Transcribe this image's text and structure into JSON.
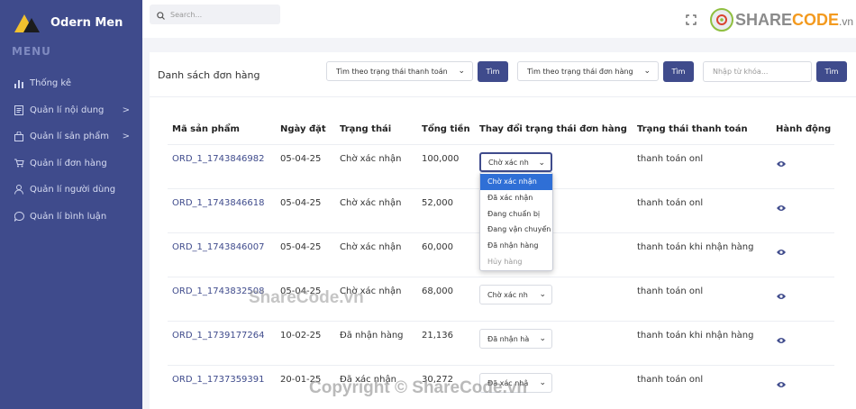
{
  "brand": {
    "name": "Odern Men"
  },
  "sidebar": {
    "menu_title": "MENU",
    "items": [
      {
        "label": "Thống kê",
        "icon": "bar-chart-icon"
      },
      {
        "label": "Quản lí nội dung",
        "icon": "document-icon",
        "chevron": ">"
      },
      {
        "label": "Quản lí sản phẩm",
        "icon": "bag-icon",
        "chevron": ">"
      },
      {
        "label": "Quản lí đơn hàng",
        "icon": "cart-icon"
      },
      {
        "label": "Quản lí người dùng",
        "icon": "user-icon"
      },
      {
        "label": "Quản lí bình luận",
        "icon": "comment-icon"
      }
    ]
  },
  "topbar": {
    "search_placeholder": "Search...",
    "watermark_logo": {
      "share": "SHARE",
      "code": "CODE",
      "vn": ".vn"
    }
  },
  "card": {
    "title": "Danh sách đơn hàng",
    "filter_payment": "Tìm theo trạng thái thanh toán",
    "filter_order": "Tìm theo trạng thái đơn hàng",
    "keyword_placeholder": "Nhập từ khóa...",
    "search_button": "Tìm"
  },
  "table": {
    "headers": [
      "Mã sản phẩm",
      "Ngày đặt",
      "Trạng thái",
      "Tổng tiền",
      "Thay đổi trạng thái đơn hàng",
      "Trạng thái thanh toán",
      "Hành động"
    ],
    "rows": [
      {
        "code": "ORD_1_1743846982",
        "date": "05-04-25",
        "status": "Chờ xác nhận",
        "total": "100,000",
        "select": "Chờ xác nh",
        "payment": "thanh toán onl"
      },
      {
        "code": "ORD_1_1743846618",
        "date": "05-04-25",
        "status": "Chờ xác nhận",
        "total": "52,000",
        "select": "",
        "payment": "thanh toán onl"
      },
      {
        "code": "ORD_1_1743846007",
        "date": "05-04-25",
        "status": "Chờ xác nhận",
        "total": "60,000",
        "select": "",
        "payment": "thanh toán khi nhận hàng"
      },
      {
        "code": "ORD_1_1743832508",
        "date": "05-04-25",
        "status": "Chờ xác nhận",
        "total": "68,000",
        "select": "Chờ xác nh",
        "payment": "thanh toán onl"
      },
      {
        "code": "ORD_1_1739177264",
        "date": "10-02-25",
        "status": "Đã nhận hàng",
        "total": "21,136",
        "select": "Đã nhận hà",
        "payment": "thanh toán khi nhận hàng"
      },
      {
        "code": "ORD_1_1737359391",
        "date": "20-01-25",
        "status": "Đã xác nhận",
        "total": "30,272",
        "select": "Đã xác nhậ",
        "payment": "thanh toán onl"
      }
    ],
    "dropdown_options": [
      "Chờ xác nhận",
      "Đã xác nhận",
      "Đang chuẩn bị",
      "Đang vận chuyển",
      "Đã nhận hàng",
      "Hủy hàng"
    ]
  },
  "watermarks": {
    "middle": "ShareCode.vn",
    "bottom": "Copyright © ShareCode.vn"
  },
  "colors": {
    "sidebar": "#3f4b8c",
    "accent": "#3f4b8c",
    "link": "#3f4b8c",
    "dropdown_active": "#2f6fd6"
  }
}
